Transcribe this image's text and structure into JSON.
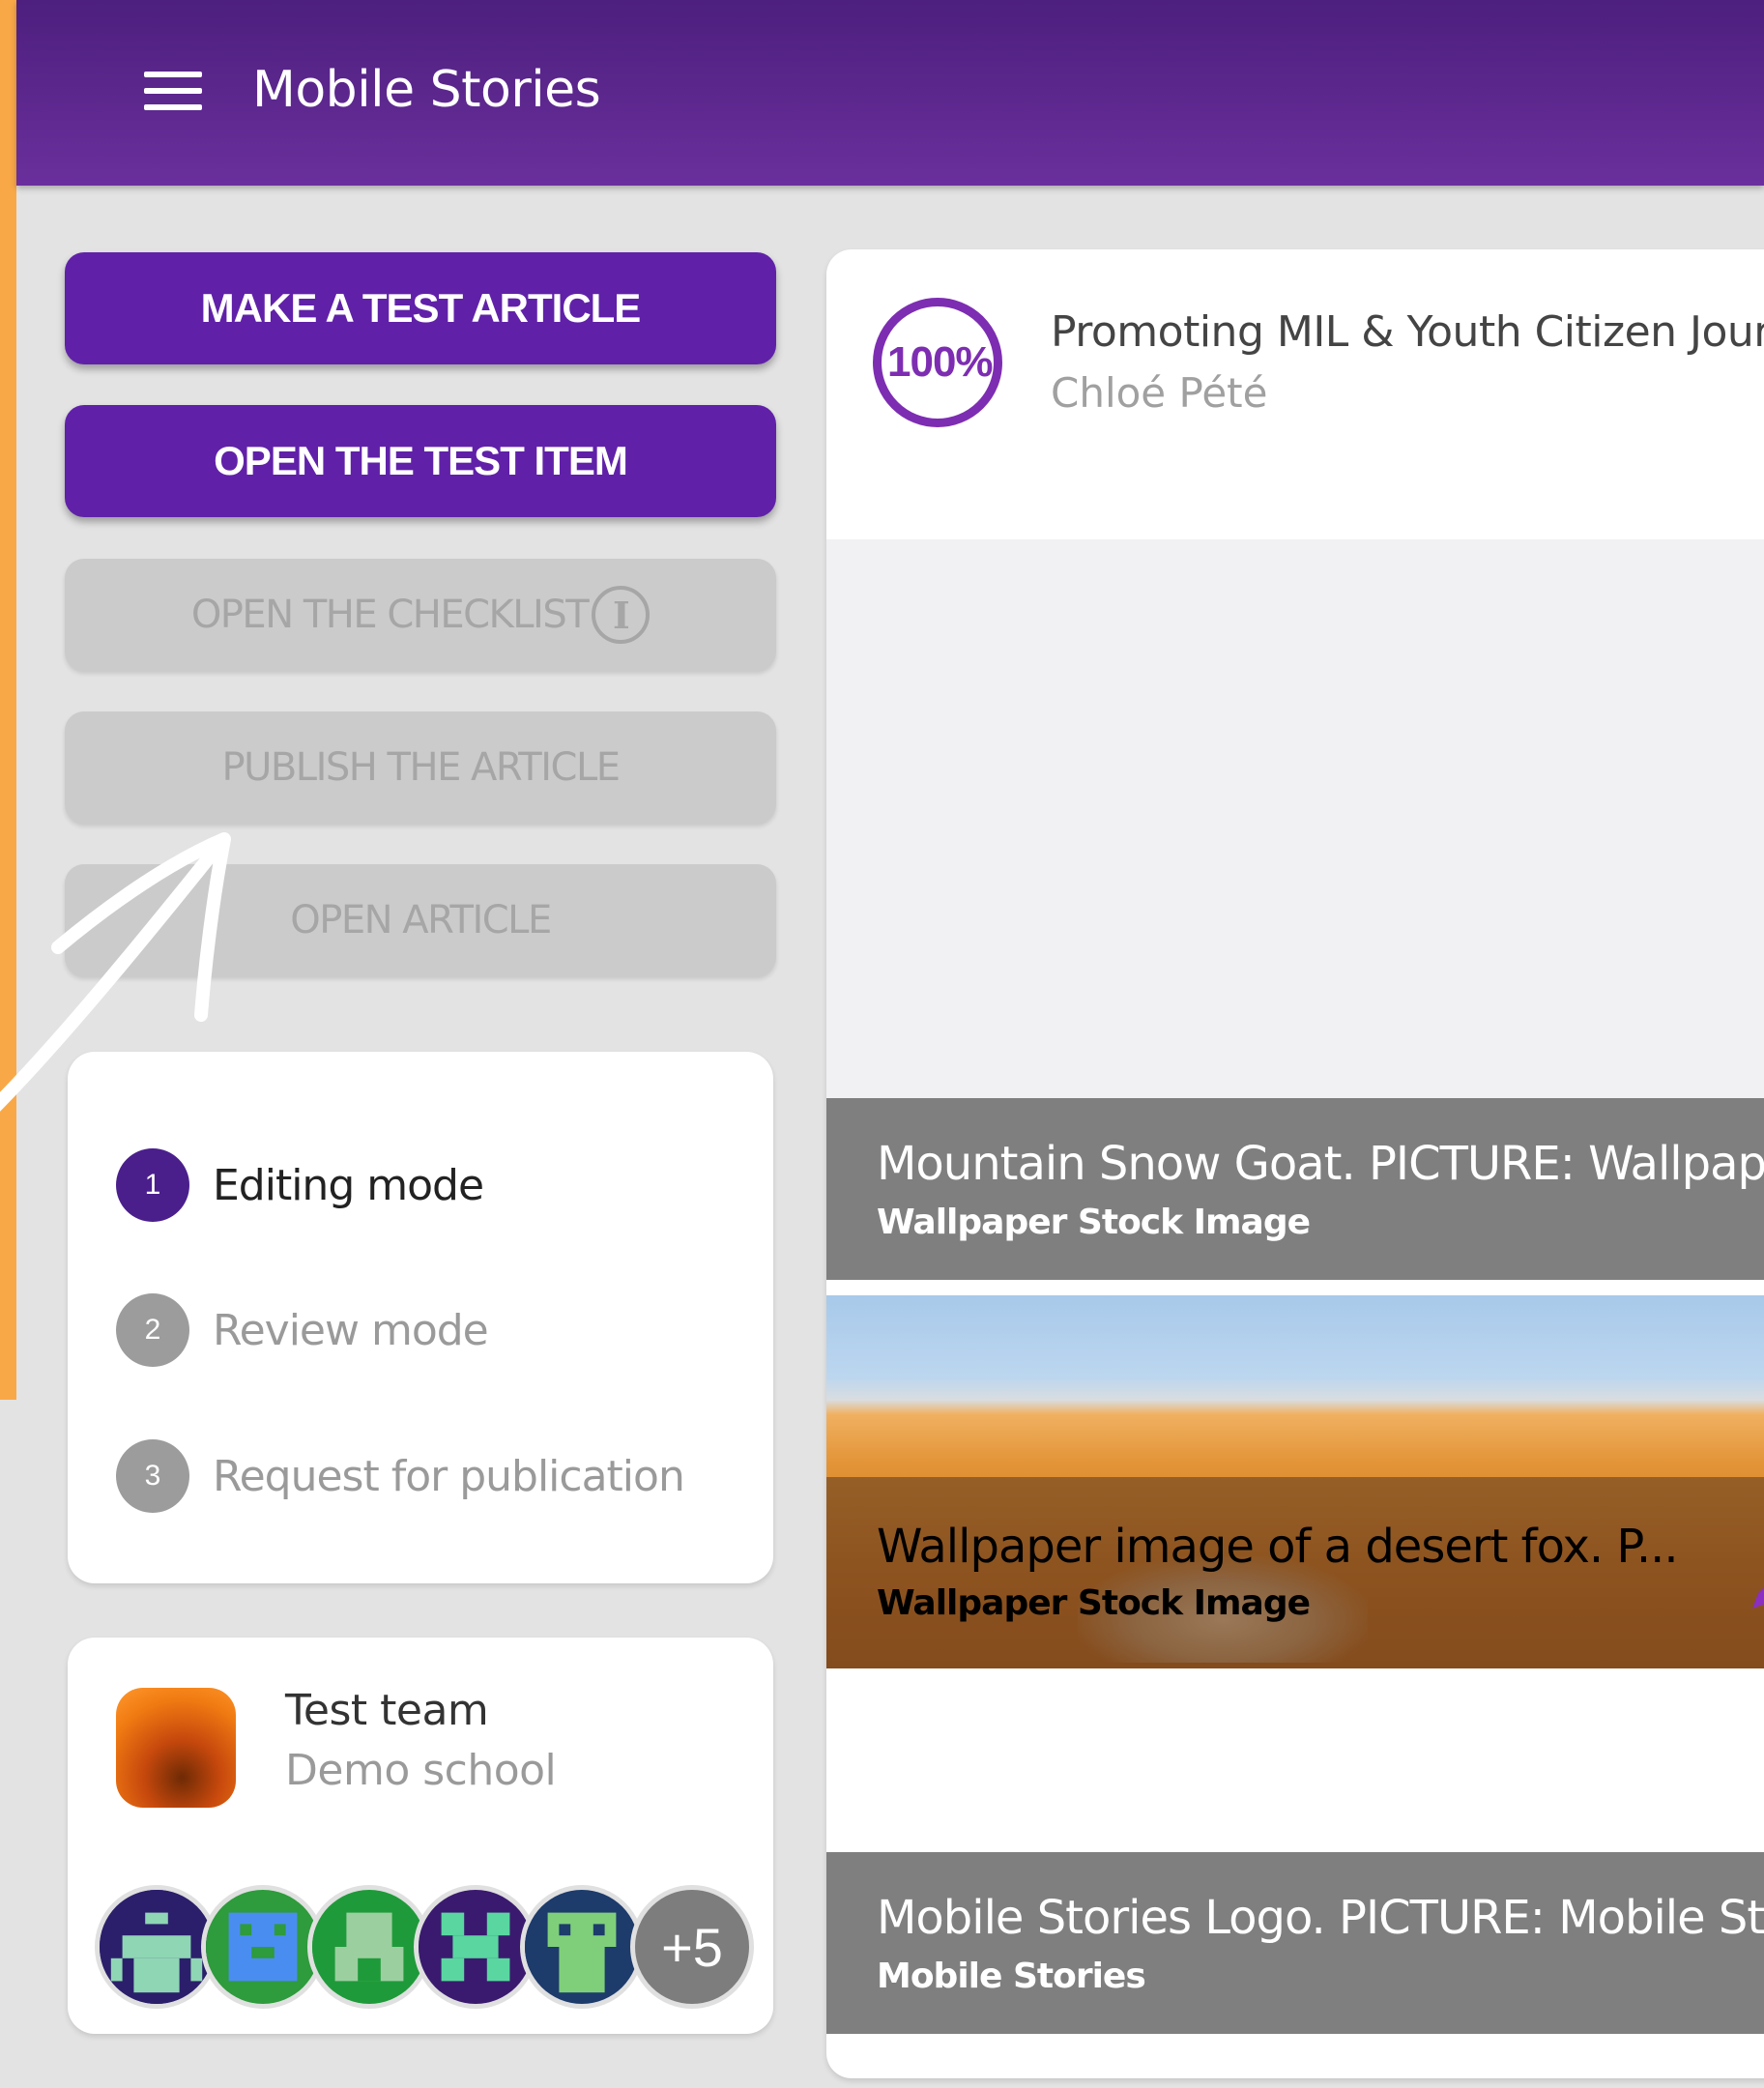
{
  "app": {
    "title": "Mobile Stories"
  },
  "actions": {
    "make_test_article": "MAKE A TEST ARTICLE",
    "open_test_item": "OPEN THE TEST ITEM",
    "open_checklist": "OPEN THE CHECKLIST",
    "publish_article": "PUBLISH THE ARTICLE",
    "open_article": "OPEN ARTICLE"
  },
  "steps": [
    {
      "number": "1",
      "label": "Editing mode",
      "state": "active"
    },
    {
      "number": "2",
      "label": "Review mode",
      "state": "inactive"
    },
    {
      "number": "3",
      "label": "Request for publication",
      "state": "inactive"
    }
  ],
  "team": {
    "name": "Test team",
    "school": "Demo school",
    "more_count": "+5"
  },
  "article": {
    "progress": "100%",
    "title": "Promoting MIL & Youth Citizen Journa",
    "author": "Chloé Pété",
    "media": [
      {
        "title": "Mountain Snow Goat. PICTURE: Wallpap",
        "credit": "Wallpaper Stock Image"
      },
      {
        "title": "Wallpaper image of a desert fox. P...",
        "credit": "Wallpaper Stock Image"
      },
      {
        "title": "Mobile Stories Logo. PICTURE: Mobile St",
        "credit": "Mobile Stories"
      }
    ]
  },
  "colors": {
    "app_bar": "#5a2690",
    "primary_button": "#6021a8",
    "active_step": "#4a1f8c",
    "progress_ring": "#7d2db2",
    "orange_strip": "#f9a847"
  },
  "icons": [
    "menu-icon",
    "info-icon",
    "pencil-icon",
    "arrow-annotation"
  ]
}
